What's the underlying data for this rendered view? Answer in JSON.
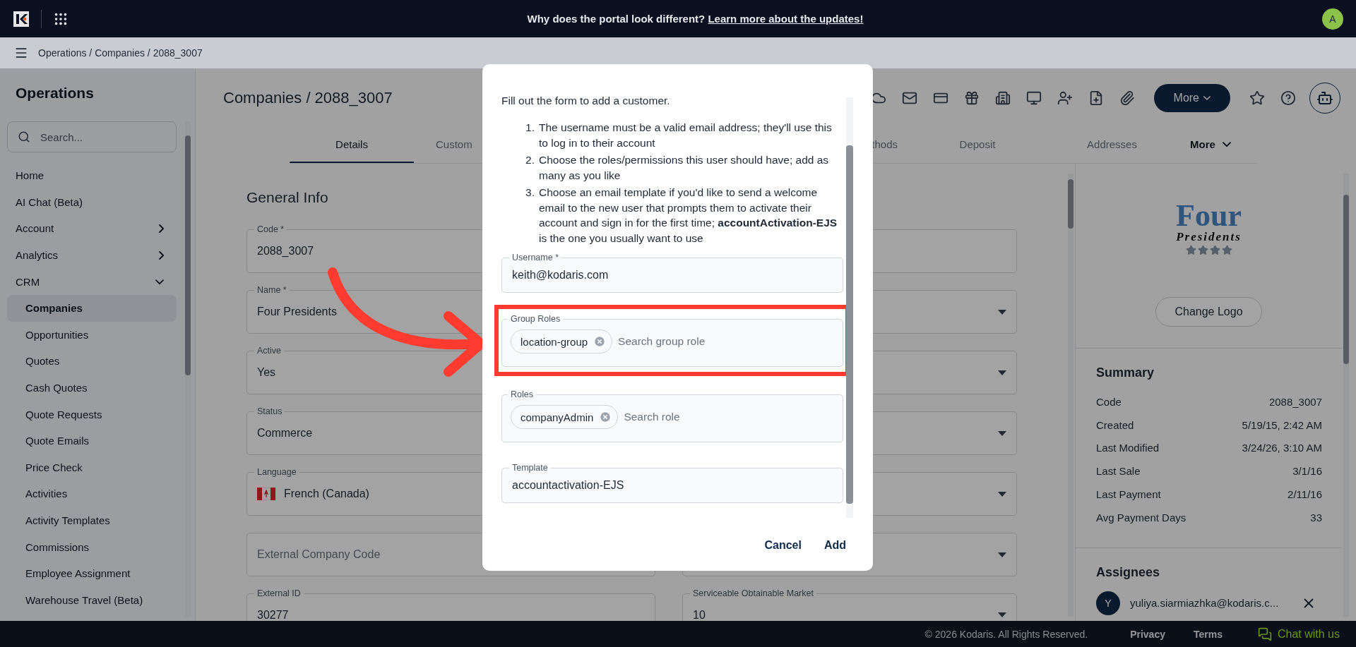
{
  "top_bar": {
    "announcement": "Why does the portal look different?",
    "link": "Learn more about the updates!",
    "avatar": "A"
  },
  "breadcrumb": "Operations / Companies / 2088_3007",
  "sidebar": {
    "title": "Operations",
    "search": {
      "placeholder": "Search..."
    },
    "items": [
      {
        "label": "Home",
        "kind": "link",
        "selected": false
      },
      {
        "label": "AI Chat (Beta)",
        "kind": "link",
        "selected": false
      },
      {
        "label": "Account",
        "kind": "group",
        "expanded": false,
        "selected": false
      },
      {
        "label": "Analytics",
        "kind": "group",
        "expanded": false,
        "selected": false
      },
      {
        "label": "CRM",
        "kind": "group",
        "expanded": true,
        "selected": false,
        "children": [
          {
            "label": "Companies",
            "selected": true
          },
          {
            "label": "Opportunities",
            "selected": false
          },
          {
            "label": "Quotes",
            "selected": false
          },
          {
            "label": "Cash Quotes",
            "selected": false
          },
          {
            "label": "Quote Requests",
            "selected": false
          },
          {
            "label": "Quote Emails",
            "selected": false
          },
          {
            "label": "Price Check",
            "selected": false
          },
          {
            "label": "Activities",
            "selected": false
          },
          {
            "label": "Activity Templates",
            "selected": false
          },
          {
            "label": "Commissions",
            "selected": false
          },
          {
            "label": "Employee Assignment",
            "selected": false
          },
          {
            "label": "Warehouse Travel (Beta)",
            "selected": false
          }
        ]
      }
    ]
  },
  "page": {
    "title": "Companies / 2088_3007",
    "more_button": "More"
  },
  "tabs": [
    {
      "label": "Details",
      "kind": "tab",
      "selected": true
    },
    {
      "label": "Custom",
      "kind": "tab",
      "selected": false
    },
    {
      "label": "thods",
      "kind": "tab",
      "selected": false
    },
    {
      "label": "Deposit",
      "kind": "tab",
      "selected": false
    },
    {
      "label": "Addresses",
      "kind": "tab",
      "selected": false
    },
    {
      "label": "More",
      "kind": "menu",
      "selected": false
    }
  ],
  "general_info": {
    "title": "General Info",
    "left_fields": [
      {
        "kind": "text",
        "label": "Code *",
        "value": "2088_3007"
      },
      {
        "kind": "text",
        "label": "Name *",
        "value": "Four Presidents"
      },
      {
        "kind": "text",
        "label": "Active",
        "value": "Yes"
      },
      {
        "kind": "text",
        "label": "Status",
        "value": "Commerce"
      },
      {
        "kind": "language",
        "label": "Language",
        "value": "French (Canada)"
      },
      {
        "kind": "text",
        "placeholder": "External Company Code"
      },
      {
        "kind": "text",
        "label": "External ID",
        "value": "30277"
      }
    ],
    "right_fields": [
      {
        "kind": "text"
      },
      {
        "kind": "select"
      },
      {
        "kind": "select"
      },
      {
        "kind": "select"
      },
      {
        "kind": "select"
      },
      {
        "kind": "select"
      },
      {
        "kind": "select",
        "label": "Serviceable Obtainable Market",
        "value": "10"
      }
    ]
  },
  "company_panel": {
    "logo": {
      "title": "Four",
      "subtitle": "Presidents"
    },
    "change_logo": "Change Logo",
    "summary": {
      "title": "Summary",
      "rows": [
        {
          "label": "Code",
          "value": "2088_3007"
        },
        {
          "label": "Created",
          "value": "5/19/15, 2:42 AM"
        },
        {
          "label": "Last Modified",
          "value": "3/24/26, 3:10 AM"
        },
        {
          "label": "Last Sale",
          "value": "3/1/16"
        },
        {
          "label": "Last Payment",
          "value": "2/11/16"
        },
        {
          "label": "Avg Payment Days",
          "value": "33"
        }
      ]
    },
    "assignees": {
      "title": "Assignees",
      "items": [
        {
          "initial": "Y",
          "email": "yuliya.siarmiazhka@kodaris.c..."
        }
      ]
    }
  },
  "dialog": {
    "intro": "Fill out the form to add a customer.",
    "steps": [
      {
        "number": "1.",
        "text": "The username must be a valid email address; they'll use this to log in to their account"
      },
      {
        "number": "2.",
        "text": "Choose the roles/permissions this user should have; add as many as you like"
      },
      {
        "number": "3.",
        "text": "Choose an email template if you'd like to send a welcome email to the new user that prompts them to activate their account and sign in for the first time; **accountActivation-EJS** is the one you usually want to use"
      }
    ],
    "fields": [
      {
        "kind": "text",
        "label": "Username *",
        "value": "keith@kodaris.com",
        "highlighted": false
      },
      {
        "kind": "chips",
        "label": "Group Roles",
        "chips": [
          "location-group"
        ],
        "placeholder": "Search group role",
        "highlighted": true
      },
      {
        "kind": "chips",
        "label": "Roles",
        "chips": [
          "companyAdmin"
        ],
        "placeholder": "Search role",
        "highlighted": false
      },
      {
        "kind": "text",
        "label": "Template",
        "value": "accountactivation-EJS",
        "highlighted": false
      }
    ],
    "buttons": [
      {
        "label": "Cancel"
      },
      {
        "label": "Add"
      }
    ]
  },
  "footer": {
    "copyright": "© 2026 Kodaris. All Rights Reserved.",
    "links": [
      "Privacy",
      "Terms"
    ],
    "chat": "Chat with us"
  }
}
